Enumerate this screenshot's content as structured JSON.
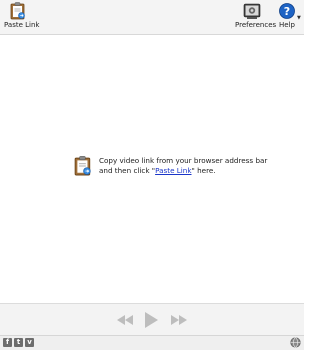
{
  "toolbar": {
    "paste_link_label": "Paste Link",
    "preferences_label": "Preferences",
    "help_label": "Help",
    "help_icon_glyph": "?"
  },
  "hint": {
    "text_before": "Copy video link from your browser address bar and then click \"",
    "link_text": "Paste Link",
    "text_after": "\" here."
  },
  "player": {
    "buttons": [
      "rewind-icon",
      "play-icon",
      "fast-forward-icon"
    ]
  },
  "statusbar": {
    "social": [
      {
        "name": "facebook-icon",
        "glyph": "f"
      },
      {
        "name": "twitter-icon",
        "glyph": "t"
      },
      {
        "name": "vimeo-icon",
        "glyph": "v"
      }
    ],
    "globe": "globe-icon"
  },
  "colors": {
    "link": "#1a35c9",
    "help_blue": "#1e63c4",
    "toolbar_bg": "#f4f4f4"
  }
}
